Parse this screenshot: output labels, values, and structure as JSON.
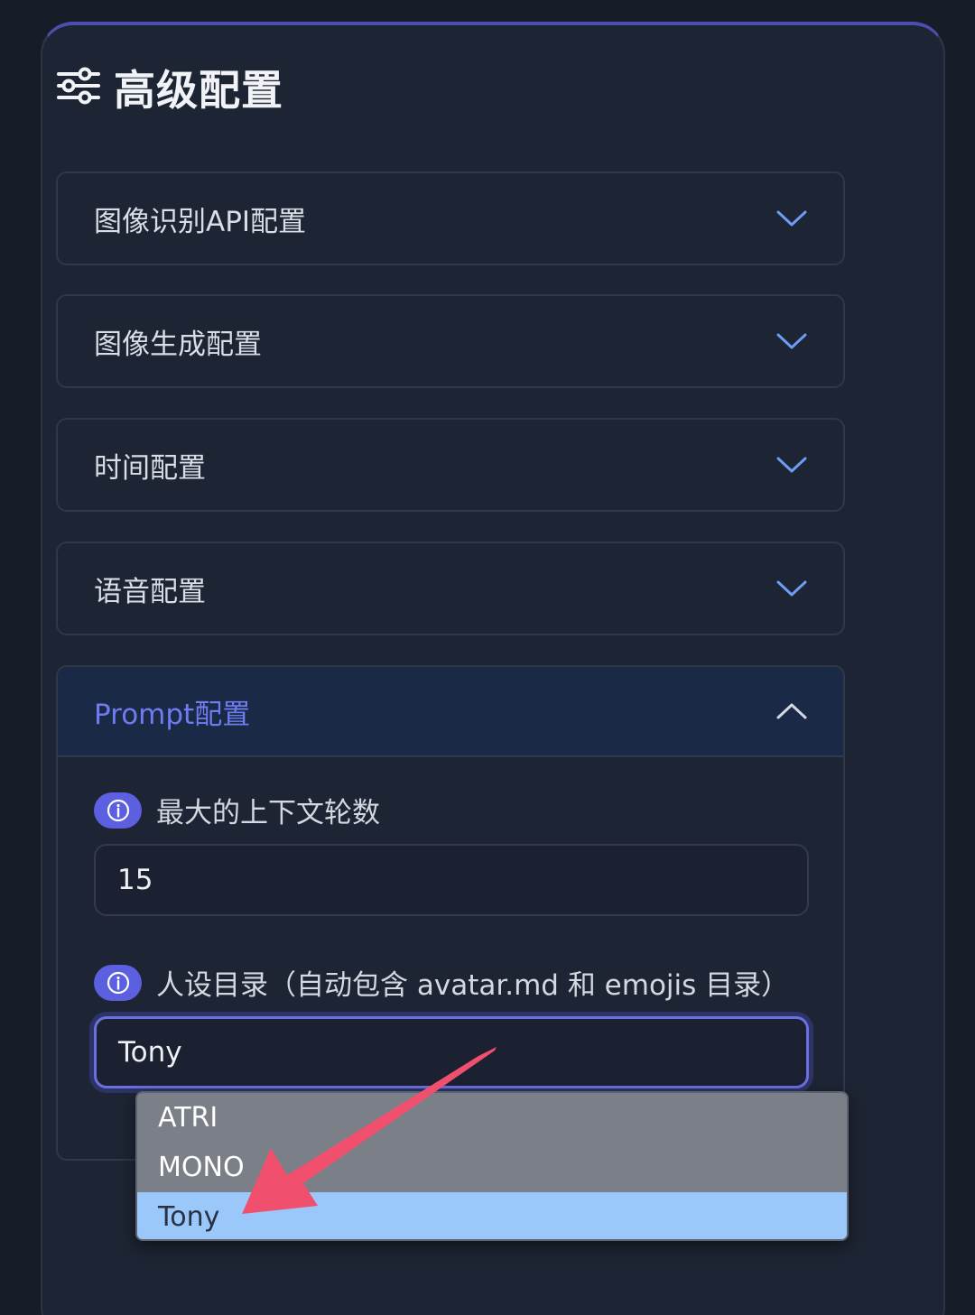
{
  "panel": {
    "title": "高级配置",
    "accent_color": "#6f7cf0"
  },
  "sections": [
    {
      "label": "图像识别API配置",
      "expanded": false
    },
    {
      "label": "图像生成配置",
      "expanded": false
    },
    {
      "label": "时间配置",
      "expanded": false
    },
    {
      "label": "语音配置",
      "expanded": false
    },
    {
      "label": "Prompt配置",
      "expanded": true
    }
  ],
  "prompt_config": {
    "max_context_rounds": {
      "label": "最大的上下文轮数",
      "value": "15"
    },
    "persona_dir": {
      "label": "人设目录（自动包含 avatar.md 和 emojis 目录）",
      "value": "Tony",
      "options": [
        "ATRI",
        "MONO",
        "Tony"
      ],
      "selected": "Tony"
    }
  },
  "annotation": {
    "arrow_color": "#f0506e"
  }
}
